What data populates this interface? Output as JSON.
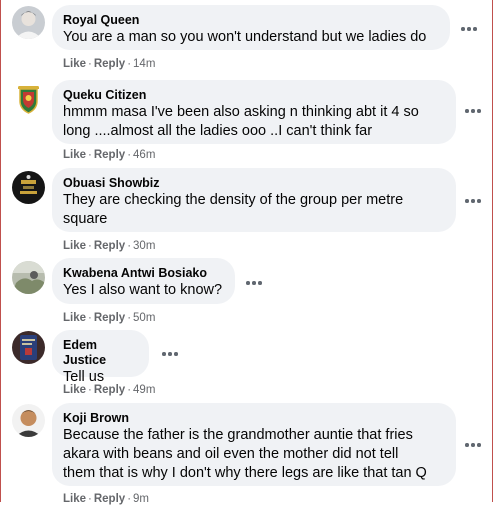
{
  "comments": [
    {
      "author": "Royal Queen",
      "text": "You are a man so you won't understand but we ladies do",
      "like": "Like",
      "reply": "Reply",
      "time": "14m",
      "avatar_icon": "profile-photo"
    },
    {
      "author": "Queku Citizen",
      "text": "hmmm masa I've been also asking n thinking abt it 4 so\nlong ....almost all the ladies ooo ..I can't think far",
      "like": "Like",
      "reply": "Reply",
      "time": "46m",
      "avatar_icon": "club-crest"
    },
    {
      "author": "Obuasi Showbiz",
      "text": "They are checking the density of the group per metre\nsquare",
      "like": "Like",
      "reply": "Reply",
      "time": "30m",
      "avatar_icon": "page-logo"
    },
    {
      "author": "Kwabena Antwi Bosiako",
      "text": "Yes I also want to know?",
      "like": "Like",
      "reply": "Reply",
      "time": "50m",
      "avatar_icon": "profile-photo"
    },
    {
      "author": "Edem Justice",
      "text": "Tell us",
      "like": "Like",
      "reply": "Reply",
      "time": "49m",
      "avatar_icon": "profile-photo"
    },
    {
      "author": "Koji Brown",
      "text": "Because the father is the grandmother auntie that fries\nakara with beans and oil even the mother did not tell\nthem that is why I don't why there legs are like that tan Q",
      "like": "Like",
      "reply": "Reply",
      "time": "9m",
      "avatar_icon": "profile-photo"
    }
  ],
  "colors": {
    "bubble": "#f0f2f5",
    "meta": "#65676b",
    "text": "#050505"
  }
}
